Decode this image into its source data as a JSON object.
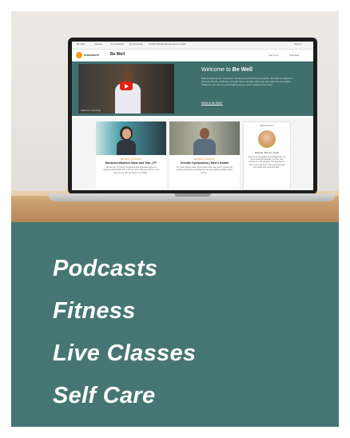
{
  "screen": {
    "topnav": [
      "Be Well",
      "Fitness",
      "Live Classes",
      "On-Demand",
      "COVID-19 Mental Resource Center"
    ],
    "topnav_search": "Search",
    "logo": "crossover",
    "brand_title": "Be Well",
    "brand_links": [
      "Self Care",
      "Podcasts"
    ],
    "hero": {
      "title_prefix": "Welcome to ",
      "title_bold": "Be Well",
      "text": "Built exclusively for Crossover members by Crossover providers, Be Well is a place to discover fitness, wellness, and self care everyday with your care team as your guide. Wherever you are on your health journey, we're excited you're here.",
      "link": "What is Be Well?",
      "video_caption": "Watch on YouTube"
    },
    "cards": [
      {
        "kicker": "BE WELL PODCAST",
        "title": "Weekend Warriors Wear and Tear | PT",
        "desc": "Nicole Lee, Physical Therapist Lead discusses how an ongoing relationship with a PT can also help you perform your best so you can get back to our daily..."
      },
      {
        "kicker": "BE WELL PODCAST",
        "title": "Erectile Dysfunction | Men's Health",
        "desc": "Dr. John Sisters talks about what most men won't. Putting off routine checkups and delaying care are making health issues worse..."
      }
    ],
    "sidebar": {
      "kicker": "BEHAVIORAL",
      "name": "Diana H. Broome, PsyD",
      "text": "Diana is an integrative psychologist who has been helping individuals, couples, and families for over 40 years. Her approach is warm and responsive. She works primarily with adults who want help with..."
    }
  },
  "features": [
    "Podcasts",
    "Fitness",
    "Live Classes",
    "Self Care"
  ],
  "colors": {
    "panel": "#467674",
    "hero": "#3f706c",
    "accent": "#f39a1f"
  }
}
